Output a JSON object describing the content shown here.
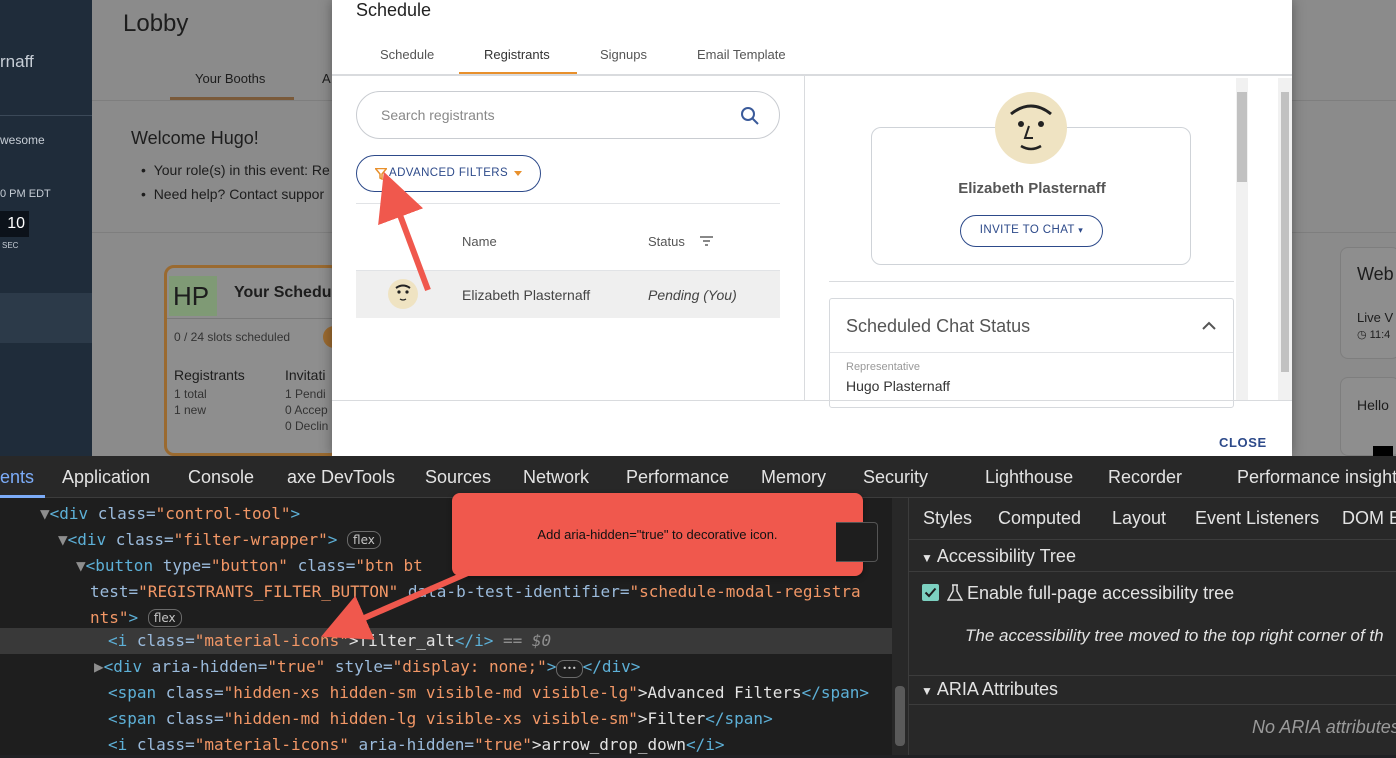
{
  "background": {
    "left_nav": {
      "partial_name": "rnaff",
      "awesome": "wesome",
      "time": "0 PM EDT",
      "countdown": "10",
      "countdown_unit": "SEC"
    },
    "lobby_title": "Lobby",
    "tabs": [
      "Your Booths",
      "A"
    ],
    "welcome": "Welcome Hugo!",
    "bullets": [
      "Your role(s) in this event: Re",
      "Need help? Contact suppor"
    ],
    "schedule_card": {
      "initials": "HP",
      "title": "Your Schedu",
      "slots": "0 / 24 slots scheduled",
      "registrants_label": "Registrants",
      "registrants_total": "1 total",
      "registrants_new": "1 new",
      "invitations_label": "Invitati",
      "inv_pending": "1 Pendi",
      "inv_accepted": "0 Accep",
      "inv_declined": "0 Declin"
    },
    "right_cards": {
      "web": "Web",
      "live": "Live V",
      "time": "11:4",
      "hello": "Hello"
    }
  },
  "modal": {
    "title": "Schedule",
    "tabs": [
      "Schedule",
      "Registrants",
      "Signups",
      "Email Template"
    ],
    "active_tab": "Registrants",
    "search_placeholder": "Search registrants",
    "advanced_filters_label": "ADVANCED FILTERS",
    "columns": {
      "name": "Name",
      "status": "Status"
    },
    "row": {
      "name": "Elizabeth Plasternaff",
      "status": "Pending (You)"
    },
    "profile": {
      "name": "Elizabeth Plasternaff",
      "invite_label": "INVITE TO CHAT"
    },
    "chat_status": {
      "title": "Scheduled Chat Status",
      "rep_label": "Representative",
      "rep_value": "Hugo Plasternaff"
    },
    "close_label": "CLOSE",
    "colors": {
      "accent": "#2d4a8a",
      "tab_underline": "#e8902c",
      "filter_icon": "#e8902c"
    }
  },
  "devtools": {
    "tabs": [
      "ents",
      "Application",
      "Console",
      "axe DevTools",
      "Sources",
      "Network",
      "Performance",
      "Memory",
      "Security",
      "Lighthouse",
      "Recorder",
      "Performance insight"
    ],
    "active_tab": "ents",
    "dom": {
      "l1_tag": "<div",
      "l1_attr": " class=",
      "l1_val": "\"control-tool\"",
      "l1_end": ">",
      "l2_tag": "<div",
      "l2_attr": " class=",
      "l2_val": "\"filter-wrapper\"",
      "l2_end": ">",
      "flex": "flex",
      "l3_tag": "<button",
      "l3_attr1": " type=",
      "l3_val1": "\"button\"",
      "l3_attr2": " class=",
      "l3_val2": "\"btn bt",
      "l4_val": "test=",
      "l4_val2": "\"REGISTRANTS_FILTER_BUTTON\"",
      "l4_attr": " data-b-test-identifier=",
      "l4_val3": "\"schedule-modal-registra",
      "l5_val": "nts\"",
      "l5_end": ">",
      "l6_tag": "<i",
      "l6_attr": " class=",
      "l6_val": "\"material-icons\"",
      "l6_text": ">filter_alt",
      "l6_close": "</i>",
      "l6_eq": " == $0",
      "l7_tag": "<div",
      "l7_attr1": " aria-hidden=",
      "l7_val1": "\"true\"",
      "l7_attr2": " style=",
      "l7_val2": "\"display: none;\"",
      "l7_end": ">",
      "l7_dots": "•••",
      "l7_close": "</div>",
      "l8_tag": "<span",
      "l8_attr": " class=",
      "l8_val": "\"hidden-xs hidden-sm visible-md visible-lg\"",
      "l8_text": ">Advanced Filters",
      "l8_close": "</span>",
      "l9_tag": "<span",
      "l9_attr": " class=",
      "l9_val": "\"hidden-md hidden-lg visible-xs visible-sm\"",
      "l9_text": ">Filter",
      "l9_close": "</span>",
      "l10_tag": "<i",
      "l10_attr1": " class=",
      "l10_val1": "\"material-icons\"",
      "l10_attr2": " aria-hidden=",
      "l10_val2": "\"true\"",
      "l10_text": ">arrow_drop_down",
      "l10_close": "</i>"
    },
    "side_tabs": [
      "Styles",
      "Computed",
      "Layout",
      "Event Listeners",
      "DOM B"
    ],
    "acc_tree": "Accessibility Tree",
    "enable_label": "Enable full-page accessibility tree",
    "moved_note": "The accessibility tree moved to the top right corner of th",
    "aria_attrs": "ARIA Attributes",
    "no_aria": "No ARIA attributes"
  },
  "callout_text": "Add aria-hidden=\"true\" to decorative icon."
}
